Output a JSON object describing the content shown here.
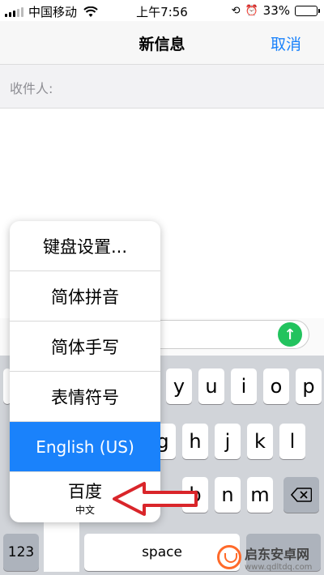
{
  "status_bar": {
    "carrier": "中国移动",
    "time": "上午7:56",
    "battery_percent_label": "33%",
    "battery_level": 0.33
  },
  "nav": {
    "title": "新信息",
    "cancel_label": "取消"
  },
  "recipient": {
    "label": "收件人:"
  },
  "keyboard_menu": {
    "items": [
      {
        "label": "键盘设置..."
      },
      {
        "label": "简体拼音"
      },
      {
        "label": "简体手写"
      },
      {
        "label": "表情符号"
      },
      {
        "label": "English (US)",
        "selected": true
      },
      {
        "label": "百度",
        "sublabel": "中文"
      }
    ]
  },
  "keyboard": {
    "row1": [
      "y",
      "u",
      "i",
      "o",
      "p"
    ],
    "row2": [
      "g",
      "h",
      "j",
      "k",
      "l"
    ],
    "row3": [
      "b",
      "n",
      "m"
    ],
    "numbers_label": "123",
    "space_label": "space"
  },
  "watermark": {
    "name": "启东安卓网",
    "url": "www.qdltdq.com"
  },
  "colors": {
    "accent": "#1a82fb",
    "send": "#22c35e",
    "arrow": "#d9252a",
    "keyboard_bg": "#d1d4d9"
  }
}
